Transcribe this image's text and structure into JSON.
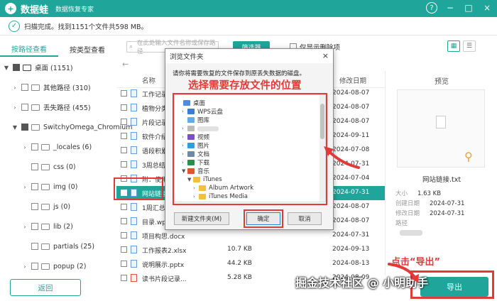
{
  "app": {
    "name": "数据蛙",
    "subtitle": "数据恢复专家",
    "logo_char": "+"
  },
  "window_controls": {
    "help": "?",
    "minimize": "−",
    "restore": "□",
    "close": "×"
  },
  "status": {
    "icon": "✓",
    "text": "扫描完成。找到1151个文件共598 MB。"
  },
  "tabs": [
    {
      "label": "按路径查看"
    },
    {
      "label": "按类型查看"
    }
  ],
  "tree": [
    {
      "label": "桌面 (1151)",
      "arrow": "▼"
    },
    {
      "label": "其他路径 (310)",
      "arrow": "›"
    },
    {
      "label": "丢失路径 (455)",
      "arrow": "›"
    },
    {
      "label": "SwitchyOmega_Chromium",
      "arrow": "▼"
    },
    {
      "label": "_locales (6)",
      "arrow": "›"
    },
    {
      "label": "css (0)",
      "arrow": ""
    },
    {
      "label": "img (0)",
      "arrow": "›"
    },
    {
      "label": "js (0)",
      "arrow": ""
    },
    {
      "label": "lib (2)",
      "arrow": "›"
    },
    {
      "label": "partials (25)",
      "arrow": ""
    },
    {
      "label": "popup (2)",
      "arrow": "›"
    }
  ],
  "search": {
    "placeholder": "在此处输入文件名称或保存路径"
  },
  "filter": {
    "label": "筛选器"
  },
  "only_deleted": {
    "label": "仅显示删除项"
  },
  "view_icons": [
    "grid-icon",
    "list-icon"
  ],
  "nav": {
    "back": "←"
  },
  "columns": {
    "name": "名称",
    "date": "修改日期"
  },
  "files": [
    {
      "name": "工作记录表",
      "size": "",
      "type": "",
      "date": "2024-08-07"
    },
    {
      "name": "植物分类.d",
      "size": "",
      "type": "",
      "date": "2024-08-07"
    },
    {
      "name": "片段记录.d",
      "size": "",
      "type": "",
      "date": "2024-08-07"
    },
    {
      "name": "软件介绍 -",
      "size": "",
      "type": "",
      "date": "2024-09-11"
    },
    {
      "name": "语段积累.d",
      "size": "",
      "type": "",
      "date": "2024-07-08"
    },
    {
      "name": "3周总结.do",
      "size": "",
      "type": "",
      "date": "2024-07-31"
    },
    {
      "name": "附：使用详",
      "size": "",
      "type": "",
      "date": "2024-07-04"
    },
    {
      "name": "网站链接.t",
      "size": "",
      "type": "",
      "date": "2024-07-31"
    },
    {
      "name": "1周汇总.do",
      "size": "",
      "type": "",
      "date": "2024-08-07"
    },
    {
      "name": "目录.wps",
      "size": "",
      "type": "",
      "date": "2024-08-07"
    },
    {
      "name": "项目构思.docx",
      "size": "",
      "type": "",
      "date": "2024-07-31"
    },
    {
      "name": "工作报表2.xlsx",
      "size": "10.7 KB",
      "type": "",
      "date": "2024-09-13"
    },
    {
      "name": "说明展示.pptx",
      "size": "44.2 KB",
      "type": "",
      "date": "2024-08-13"
    },
    {
      "name": "读书片段记录...",
      "size": "5.28 KB",
      "type": "",
      "date": "2024-08-09"
    }
  ],
  "preview": {
    "title": "预览",
    "filename": "网站链接.txt",
    "size_label": "大小",
    "size": "1.63 KB",
    "created_label": "创建日期",
    "created": "2024-07-31",
    "modified_label": "修改日期",
    "modified": "2024-07-31",
    "path_label": "路径"
  },
  "dialog": {
    "title": "浏览文件夹",
    "close": "×",
    "prompt": "请你将需要恢复的文件保存到原丢失数据的磁盘。",
    "annotation": "选择需要存放文件的位置",
    "folders": [
      {
        "label": "桌面",
        "arrow": ""
      },
      {
        "label": "WPS云盘",
        "arrow": "›"
      },
      {
        "label": "图库",
        "arrow": ""
      },
      {
        "label": "",
        "arrow": "›"
      },
      {
        "label": "视频",
        "arrow": "›"
      },
      {
        "label": "图片",
        "arrow": "›"
      },
      {
        "label": "文档",
        "arrow": "›"
      },
      {
        "label": "下载",
        "arrow": "›"
      },
      {
        "label": "音乐",
        "arrow": "▼"
      },
      {
        "label": "iTunes",
        "arrow": "▼"
      },
      {
        "label": "Album Artwork",
        "arrow": "›"
      },
      {
        "label": "iTunes Media",
        "arrow": "›"
      }
    ],
    "new_folder": "新建文件夹(M)",
    "ok": "确定",
    "cancel": "取消"
  },
  "annotations": {
    "export_hint": "点击“导出”"
  },
  "footer": {
    "back": "返回",
    "export": "导出"
  },
  "watermark": "掘金技术社区 @ 小明助手",
  "colors": {
    "accent": "#1fa59a",
    "highlight": "#e23a3a"
  }
}
